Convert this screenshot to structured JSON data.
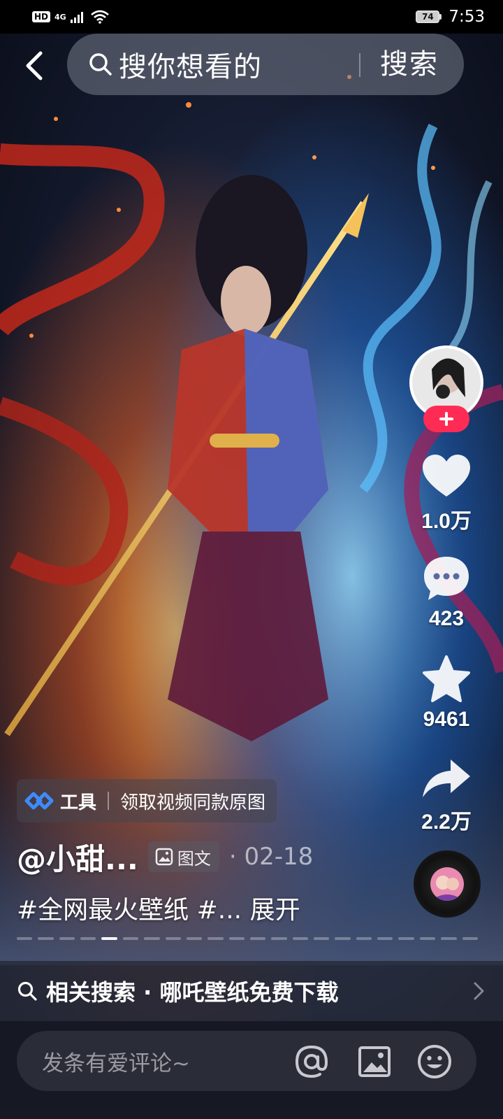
{
  "status_bar": {
    "hd": "HD",
    "network": "4G",
    "battery": "74",
    "time": "7:53"
  },
  "search": {
    "placeholder": "搜你想看的",
    "button": "搜索"
  },
  "actions": {
    "likes": "1.0万",
    "comments": "423",
    "favorites": "9461",
    "shares": "2.2万"
  },
  "post": {
    "tool_label": "工具",
    "tool_action": "领取视频同款原图",
    "author": "@小甜...",
    "type_label": "图文",
    "date": "· 02-18",
    "caption": "#全网最火壁纸 #...",
    "expand": "展开",
    "progress": {
      "current": 5,
      "total": 22
    }
  },
  "related": {
    "text": "相关搜索 · 哪吒壁纸免费下载"
  },
  "comment_bar": {
    "placeholder": "发条有爱评论~"
  },
  "colors": {
    "follow": "#fe2c55",
    "bottom_bar": "#161823"
  }
}
